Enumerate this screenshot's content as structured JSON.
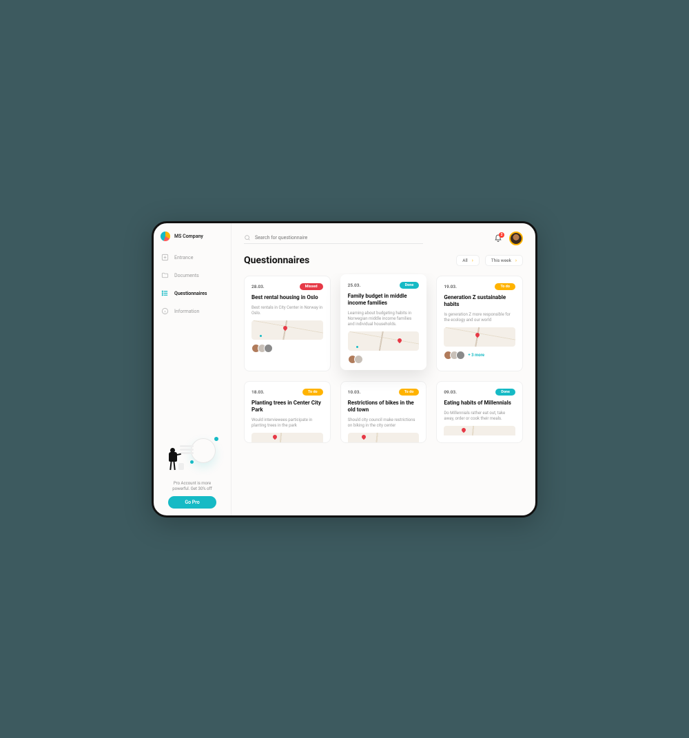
{
  "brand": {
    "name": "MS Company"
  },
  "nav": {
    "items": [
      {
        "icon": "plus-box-icon",
        "label": "Entrance"
      },
      {
        "icon": "folder-icon",
        "label": "Documents"
      },
      {
        "icon": "list-icon",
        "label": "Questionnaires",
        "active": true
      },
      {
        "icon": "info-icon",
        "label": "Information"
      }
    ]
  },
  "promo": {
    "text": "Pro Account is more powerful. Get 30% off",
    "button": "Go Pro"
  },
  "search": {
    "placeholder": "Search for questionnaire"
  },
  "notifications": {
    "count": "2"
  },
  "header": {
    "title": "Questionnaires"
  },
  "filters": {
    "scope": "All",
    "range": "This week"
  },
  "status_labels": {
    "missed": "Missed",
    "done": "Done",
    "todo": "To do"
  },
  "cards_row1": [
    {
      "date": "28.03.",
      "status": "missed",
      "title": "Best rental housing in Oslo",
      "desc": "Best rentals in City Center in Norway in Oslo.",
      "people": 3
    },
    {
      "date": "25.03.",
      "status": "done",
      "title": "Family budget in middle income families",
      "desc": "Learning about budgeting habits in Norwegian middle income families and individual households.",
      "people": 2,
      "elevated": true
    },
    {
      "date": "19.03.",
      "status": "todo",
      "title": "Generation Z sustainable habits",
      "desc": "Is generation Z more responsible for the ecology and our world",
      "people": 3,
      "more": "+ 3 more"
    }
  ],
  "cards_row2": [
    {
      "date": "18.03.",
      "status": "todo",
      "title": "Planting trees in Center City Park",
      "desc": "Would interviewees participate in planting trees in the park"
    },
    {
      "date": "10.03.",
      "status": "todo",
      "title": "Restrictions of bikes in the old town",
      "desc": "Should city council make restrictions on biking in the city center"
    },
    {
      "date": "09.03.",
      "status": "done",
      "title": "Eating habits of Millennials",
      "desc": "Do Millennials rather eat out, take away, order or cook their meals."
    }
  ]
}
